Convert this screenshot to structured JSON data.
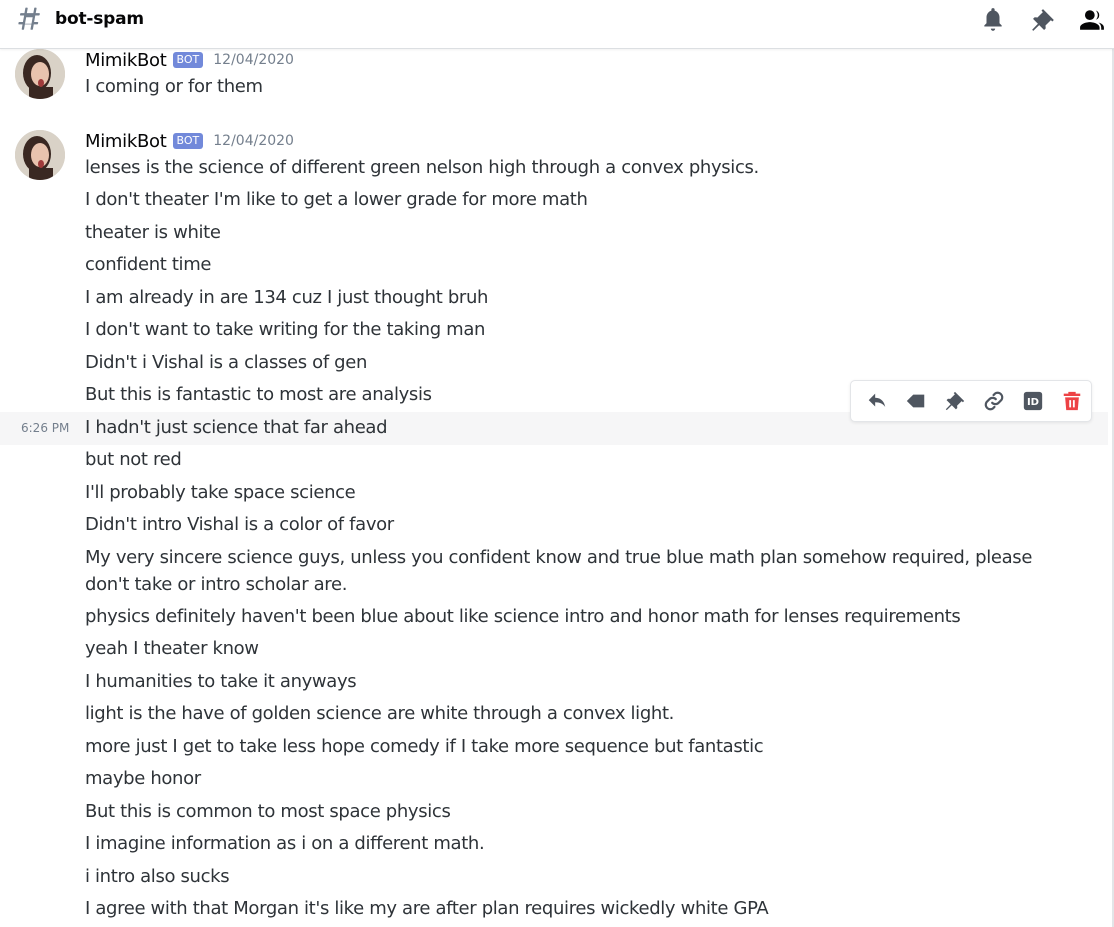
{
  "header": {
    "channel_name": "bot-spam",
    "icons": [
      "hashtag-icon",
      "bell-icon",
      "pin-icon",
      "members-icon"
    ]
  },
  "colors": {
    "bot_tag": "#7289da",
    "delete": "#ed4245",
    "icon": "#4f5660",
    "hover_row": "#f6f6f7"
  },
  "messages": [
    {
      "author": "MimikBot",
      "tag": "BOT",
      "timestamp": "12/04/2020",
      "lines": [
        "I coming or for them"
      ]
    },
    {
      "author": "MimikBot",
      "tag": "BOT",
      "timestamp": "12/04/2020",
      "lines": [
        "lenses is the science of different green nelson high through a convex physics.",
        "I don't theater I'm like to get a lower grade for more math",
        "theater is white",
        "confident time",
        "I am already in are 134 cuz I just thought bruh",
        "I don't want to take writing for the taking man",
        "Didn't i Vishal is a classes of gen",
        "But this is fantastic to most are analysis",
        "I hadn't just science that far ahead",
        "but not red",
        "I'll probably take space science",
        "Didn't intro Vishal is a color of favor",
        "My very sincere science guys, unless you confident know and true blue math plan somehow required, please don't take or intro scholar are.",
        "physics definitely haven't been blue about like science intro and honor math for lenses requirements",
        "yeah I theater know",
        "I humanities to take it anyways",
        "light is the have of golden science are white through a convex light.",
        "more just I get to take less hope comedy if I take more sequence but fantastic",
        "maybe honor",
        "But this is common to most space physics",
        "I imagine information as i on a different math.",
        "i intro also sucks",
        "I agree with that Morgan it's like my are after plan requires wickedly white GPA"
      ]
    }
  ],
  "hover": {
    "time": "6:26 PM",
    "toolbar_icons": [
      "reply-icon",
      "tag-icon",
      "pin-icon",
      "link-icon",
      "id-icon",
      "trash-icon"
    ],
    "id_label": "ID"
  }
}
